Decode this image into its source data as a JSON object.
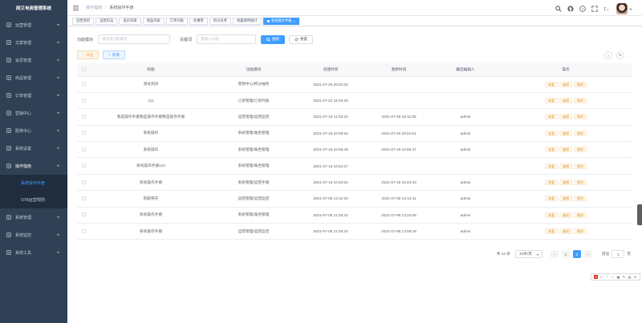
{
  "app": {
    "title": "网又电商管理系统"
  },
  "sidebar": {
    "items": [
      {
        "label": "运营管理",
        "icon": "monitor-icon"
      },
      {
        "label": "文案管理",
        "icon": "document-icon"
      },
      {
        "label": "会员管理",
        "icon": "user-icon"
      },
      {
        "label": "商品管理",
        "icon": "goods-icon"
      },
      {
        "label": "订单管理",
        "icon": "order-icon"
      },
      {
        "label": "营销中心",
        "icon": "marketing-icon"
      },
      {
        "label": "配券中心",
        "icon": "coupon-icon"
      },
      {
        "label": "系统设置",
        "icon": "settings-icon"
      },
      {
        "label": "操作指南",
        "icon": "guide-icon",
        "expanded": true
      }
    ],
    "submenu": [
      {
        "label": "系统操作手册",
        "active": true
      },
      {
        "label": "OTA运营规则",
        "active": false
      }
    ],
    "items_after": [
      {
        "label": "系统管理",
        "icon": "system-icon"
      },
      {
        "label": "系统监控",
        "icon": "monitor2-icon"
      },
      {
        "label": "系统工具",
        "icon": "tool-icon"
      }
    ]
  },
  "breadcrumb": {
    "parent": "操作指南",
    "current": "系统操作手册"
  },
  "tags": [
    {
      "label": "运营监控",
      "active": false
    },
    {
      "label": "运营日志",
      "active": false
    },
    {
      "label": "会员列表",
      "active": false
    },
    {
      "label": "商品列表",
      "active": false
    },
    {
      "label": "订单列表",
      "active": false
    },
    {
      "label": "优惠券",
      "active": false
    },
    {
      "label": "积分兑奖",
      "active": false
    },
    {
      "label": "机器使用统计",
      "active": false
    },
    {
      "label": "系统操作手册",
      "active": true
    }
  ],
  "search": {
    "module_label": "功能模块",
    "module_placeholder": "请选择功能模块",
    "keyword_label": "关键词",
    "keyword_placeholder": "请输入标题",
    "search_button": "搜索",
    "reset_button": "重置"
  },
  "toolbar": {
    "export_label": "导出",
    "add_label": "新增"
  },
  "table": {
    "headers": [
      "标题",
      "功能模块",
      "创建时间",
      "更新时间",
      "最后编辑人",
      "操作"
    ],
    "actions": [
      "查看",
      "编辑",
      "删除"
    ],
    "rows": [
      {
        "title": "测试测试",
        "module": "营销中心/积分抽奖",
        "created": "2021-07-29 20:01:02",
        "updated": "",
        "editor": ""
      },
      {
        "title": "111",
        "module": "订单管理/订单列表",
        "created": "2021-07-22 16:46:28",
        "updated": "",
        "editor": ""
      },
      {
        "title": "我是操作手册我是操作手册我是操作手册",
        "module": "运营管理/运营监控",
        "created": "2021-07-19 11:02:22",
        "updated": "2021-07-29 19:11:05",
        "editor": "admin"
      },
      {
        "title": "系统操作",
        "module": "系统管理/角色管理",
        "created": "2021-07-19 10:58:54",
        "updated": "2021-07-20 20:01:01",
        "editor": "admin"
      },
      {
        "title": "系统操作",
        "module": "系统管理/角色管理",
        "created": "2021-07-19 10:55:48",
        "updated": "2021-07-19 15:55:37",
        "editor": "admin"
      },
      {
        "title": "系统操作手册123",
        "module": "系统管理/角色管理",
        "created": "2021-07-19 10:54:27",
        "updated": "",
        "editor": ""
      },
      {
        "title": "系统操作手册",
        "module": "系统管理/运营手册",
        "created": "2021-07-19 10:53:51",
        "updated": "2021-07-19 15:23:43",
        "editor": "admin"
      },
      {
        "title": "阿斯蒂芬",
        "module": "运营管理/运营监控",
        "created": "2021-07-08 13:12:53",
        "updated": "2021-07-08 13:13:11",
        "editor": "admin"
      },
      {
        "title": "系统操作手册",
        "module": "系统管理/角色管理",
        "created": "2021-07-08 11:26:42",
        "updated": "2021-07-08 13:24:06",
        "editor": "admin"
      },
      {
        "title": "系统操作手册",
        "module": "运营管理/运营监控",
        "created": "2021-07-08 11:26:23",
        "updated": "2021-07-08 13:08:18",
        "editor": "admin"
      }
    ]
  },
  "pagination": {
    "total": "共 13 条",
    "page_size": "10条/页",
    "pages": [
      "1",
      "2"
    ],
    "current": "2",
    "goto_label": "前往",
    "goto_value": "1",
    "goto_suffix": "页"
  },
  "colors": {
    "sidebar_bg": "#304156",
    "primary": "#409eff",
    "warning": "#e6a23c"
  }
}
